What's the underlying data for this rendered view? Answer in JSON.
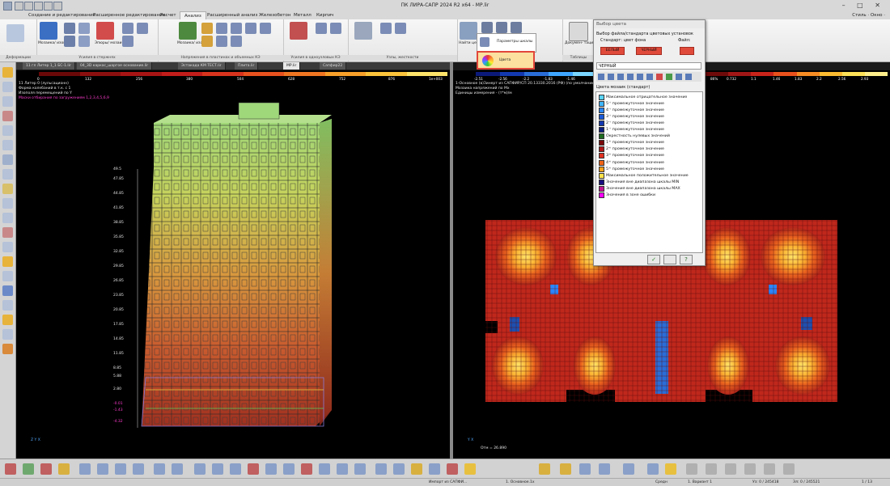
{
  "window": {
    "title": "ПК ЛИРА-САПР 2024 R2 x64 - МР.lir",
    "controls": "– □ ✕"
  },
  "ribbon_tabs": [
    "Создание и редактирование",
    "Расширенное редактирование",
    "Расчет",
    "Анализ",
    "Расширенный анализ",
    "Железобетон",
    "Металл",
    "Кирпич"
  ],
  "active_tab": "Анализ",
  "style_label": "Стиль · Окно ·",
  "ribbon_groups": [
    "Деформации",
    "Усилия в стержнях",
    "Напряжения в пластинах и объемных КЭ",
    "Усилия в одноузловых КЭ",
    "Узлы, жесткости",
    "Таблицы"
  ],
  "ribbon_buttons": {
    "mosaic1": "Мозаика/ изополя",
    "epures": "Эпюры/ мозаика",
    "mosaic2": "Мозаика/ изополя",
    "find_center": "Найти центр",
    "scale_params": "Параметры шкалы",
    "colors": "Цвета",
    "documentation": "Докумен- тация"
  },
  "doc_tabs": [
    "11 гл Литер 1_1 БС-1.lir",
    "04_3D каркас_шаргое основание.lir",
    "Эстакада КМ ТЕСТ.lir",
    "Плита.lir",
    "МР.lir",
    "Сапфир22"
  ],
  "active_doc_tab": "МР.lir",
  "viewport_left": {
    "scale_labels": [
      "0",
      "132",
      "256",
      "380",
      "504",
      "628",
      "752",
      "876",
      "1e+003"
    ],
    "info": [
      "11 Литер 0 (лульсационн)",
      "Форма колебаний в т.к. с 1",
      "Изополя перемещений по Y",
      "Маски отбирания по загружениям 1,2,3,4,5,6,9"
    ],
    "level_marks": [
      "49.5",
      "47.85",
      "44.85",
      "41.85",
      "38.85",
      "35.85",
      "32.85",
      "29.85",
      "26.85",
      "23.85",
      "20.85",
      "17.85",
      "14.85",
      "11.85",
      "8.85",
      "5.88",
      "2.80",
      "-0.01",
      "-1.43",
      "-4.32"
    ],
    "axis": "Z Y X"
  },
  "viewport_right": {
    "scale_labels_left": [
      "-2.51",
      "-2.56",
      "-2.2",
      "-1.83",
      "-1.46"
    ],
    "scale_labels_right": [
      "86%",
      "0.732",
      "1.1",
      "1.46",
      "1.83",
      "2.2",
      "2.56",
      "2.93"
    ],
    "info": [
      "1-Основное (в)Зинерт из САПФИР/СП 20.13330.2016 (РФ) (по умолчанию)",
      "Мозаика напряжений по Мх",
      "Единицы измерения - (т*м)/м"
    ],
    "angle_text": "Отм = 26.890"
  },
  "dialog": {
    "title": "Выбор цвета",
    "file_label": "Выбор файла/стандарта цветовых установок",
    "standard_label": "Стандарт: цвет фона",
    "file_short": "Файл:",
    "btn_white": "БЕЛЫЙ",
    "btn_black": "ЧЕРНЫЙ",
    "current_bg": "ЧЕРНЫЙ",
    "mosaic_label": "Цвета мозаик (стандарт)",
    "items": [
      {
        "label": "Максимальное отрицательное значение",
        "color": "#5ad4ff"
      },
      {
        "label": "5⁻ⁱ промежуточное значение",
        "color": "#3fb6ff"
      },
      {
        "label": "4⁻ⁱ промежуточное значение",
        "color": "#2a86ff"
      },
      {
        "label": "3⁻ⁱ промежуточное значение",
        "color": "#1a5ad8"
      },
      {
        "label": "2⁻ⁱ промежуточное значение",
        "color": "#1339b0"
      },
      {
        "label": "1⁻ⁱ промежуточное значение",
        "color": "#0d2080"
      },
      {
        "label": "Окрестность нулевых значений",
        "color": "#1f6a1f"
      },
      {
        "label": "1⁺ⁱ промежуточное значение",
        "color": "#7a0a0a"
      },
      {
        "label": "2⁺ⁱ промежуточное значение",
        "color": "#b01818"
      },
      {
        "label": "3⁺ⁱ промежуточное значение",
        "color": "#e03020"
      },
      {
        "label": "4⁺ⁱ промежуточное значение",
        "color": "#f06418"
      },
      {
        "label": "5⁺ⁱ промежуточное значение",
        "color": "#f9a21c"
      },
      {
        "label": "Максимальное положительное значение",
        "color": "#ffe14a"
      },
      {
        "label": "Значения вне диапазона шкалы MIN",
        "color": "#1a0f80"
      },
      {
        "label": "Значения вне диапазона шкалы MAX",
        "color": "#c01890"
      },
      {
        "label": "Значения в зоне ошибки",
        "color": "#ff00ff"
      }
    ]
  },
  "statusbar": {
    "left": "Импорт из САПФИ...",
    "mid1": "1. Основное.1x",
    "mid2": "Средн",
    "mid3": "1. Вариант 1",
    "right1": "Уз: 0 / 245418",
    "right2": "Эл: 0 / 245521",
    "right3": "1 / 13"
  },
  "colors": {
    "mosaic_scale": [
      "#6a0808",
      "#8c0f0f",
      "#a81414",
      "#c21d1a",
      "#d8341d",
      "#e8521e",
      "#f07622",
      "#f7a02a",
      "#fbc43b",
      "#fde46a"
    ],
    "right_scale": [
      "#6e0a0a",
      "#a01616",
      "#c9241a",
      "#e8501c",
      "#f68c24",
      "#fbbc32",
      "#fde158",
      "#ffef8c"
    ]
  }
}
